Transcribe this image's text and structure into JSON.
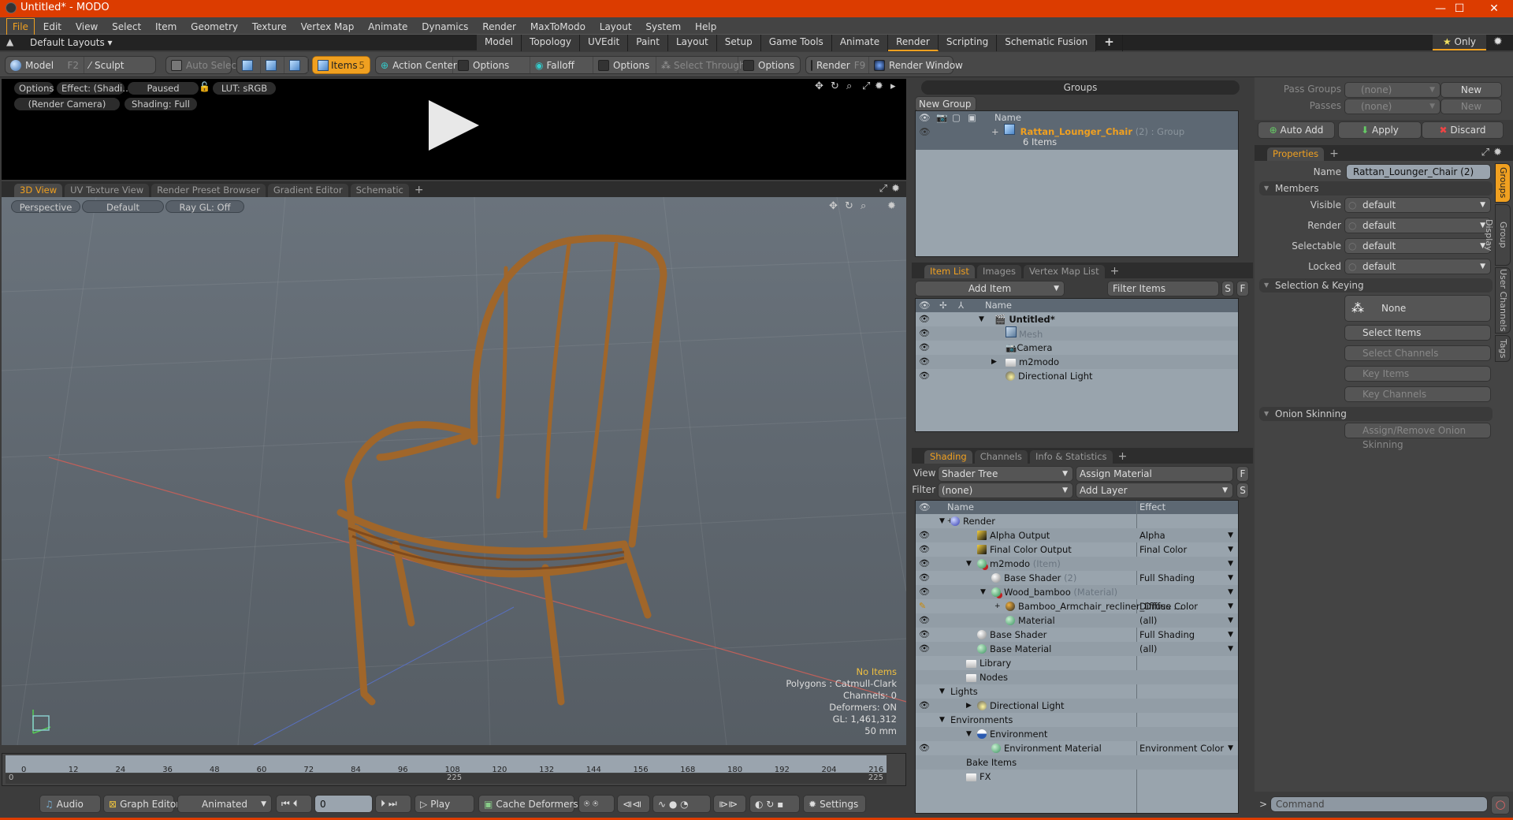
{
  "window": {
    "title": "Untitled* - MODO",
    "controls": [
      "minimize",
      "maximize",
      "close"
    ]
  },
  "menu": [
    "File",
    "Edit",
    "View",
    "Select",
    "Item",
    "Geometry",
    "Texture",
    "Vertex Map",
    "Animate",
    "Dynamics",
    "Render",
    "MaxToModo",
    "Layout",
    "System",
    "Help"
  ],
  "layout_bar": {
    "layouts_label": "Default Layouts",
    "tabs": [
      "Model",
      "Topology",
      "UVEdit",
      "Paint",
      "Layout",
      "Setup",
      "Game Tools",
      "Animate",
      "Render",
      "Scripting",
      "Schematic Fusion"
    ],
    "active_tab": "Render",
    "only_label": "Only"
  },
  "toolbar": {
    "model": "Model",
    "model_key": "F2",
    "sculpt": "Sculpt",
    "auto_select": "Auto Select",
    "items": "Items",
    "items_count": "5",
    "action_center": "Action Center",
    "options1": "Options",
    "falloff": "Falloff",
    "options2": "Options",
    "select_through": "Select Through",
    "options3": "Options",
    "render": "Render",
    "render_key": "F9",
    "render_window": "Render Window"
  },
  "render_view": {
    "options": "Options",
    "effect": "Effect: (Shadi…",
    "status": "Paused",
    "lut": "LUT: sRGB",
    "camera": "(Render Camera)",
    "shading": "Shading: Full"
  },
  "view_tabs": {
    "tabs": [
      "3D View",
      "UV Texture View",
      "Render Preset Browser",
      "Gradient Editor",
      "Schematic"
    ],
    "active": "3D View"
  },
  "viewport": {
    "perspective": "Perspective",
    "style": "Default",
    "raygl": "Ray GL: Off",
    "stats": {
      "selection": "No Items",
      "polygons": "Polygons : Catmull-Clark",
      "channels": "Channels: 0",
      "deformers": "Deformers: ON",
      "gl": "GL: 1,461,312",
      "focal": "50 mm"
    }
  },
  "timeline": {
    "ticks": [
      "0",
      "12",
      "24",
      "36",
      "48",
      "60",
      "72",
      "84",
      "96",
      "108",
      "120",
      "132",
      "144",
      "156",
      "168",
      "180",
      "192",
      "204",
      "216"
    ],
    "range_start": "0",
    "range_mid": "225",
    "range_end": "225"
  },
  "transport": {
    "audio": "Audio",
    "graph_editor": "Graph Editor",
    "mode": "Animated",
    "frame": "0",
    "play": "Play",
    "cache_deformers": "Cache Deformers",
    "settings": "Settings"
  },
  "groups": {
    "title": "Groups",
    "new_group": "New Group",
    "col_name": "Name",
    "rows": [
      {
        "name": "Rattan_Lounger_Chair",
        "count": "(2)",
        "type": ": Group",
        "items": "6 Items"
      }
    ]
  },
  "item_list": {
    "tabs": [
      "Item List",
      "Images",
      "Vertex Map List"
    ],
    "active": "Item List",
    "add_item": "Add Item",
    "filter_placeholder": "Filter Items",
    "s_btn": "S",
    "f_btn": "F",
    "col_name": "Name",
    "rows": [
      {
        "name": "Untitled*",
        "kind": "scene"
      },
      {
        "name": "Mesh",
        "kind": "mesh"
      },
      {
        "name": "Camera",
        "kind": "camera"
      },
      {
        "name": "m2modo",
        "kind": "group"
      },
      {
        "name": "Directional Light",
        "kind": "light"
      }
    ]
  },
  "shading": {
    "tabs": [
      "Shading",
      "Channels",
      "Info & Statistics"
    ],
    "active": "Shading",
    "view_label": "View",
    "view_value": "Shader Tree",
    "assign_material": "Assign Material",
    "f_btn": "F",
    "filter_label": "Filter",
    "filter_value": "(none)",
    "add_layer": "Add Layer",
    "s_btn": "S",
    "col_name": "Name",
    "col_effect": "Effect",
    "rows": [
      {
        "name": "Render",
        "suffix": "",
        "effect": ""
      },
      {
        "name": "Alpha Output",
        "suffix": "",
        "effect": "Alpha"
      },
      {
        "name": "Final Color Output",
        "suffix": "",
        "effect": "Final Color"
      },
      {
        "name": "m2modo",
        "suffix": "(Item)",
        "effect": ""
      },
      {
        "name": "Base Shader",
        "suffix": "(2)",
        "effect": "Full Shading"
      },
      {
        "name": "Wood_bamboo",
        "suffix": "(Material)",
        "effect": ""
      },
      {
        "name": "Bamboo_Armchair_recliner_Diffus …",
        "suffix": "",
        "effect": "Diffuse Color"
      },
      {
        "name": "Material",
        "suffix": "",
        "effect": "(all)"
      },
      {
        "name": "Base Shader",
        "suffix": "",
        "effect": "Full Shading"
      },
      {
        "name": "Base Material",
        "suffix": "",
        "effect": "(all)"
      },
      {
        "name": "Library",
        "suffix": "",
        "effect": ""
      },
      {
        "name": "Nodes",
        "suffix": "",
        "effect": ""
      },
      {
        "name": "Lights",
        "suffix": "",
        "effect": ""
      },
      {
        "name": "Directional Light",
        "suffix": "",
        "effect": ""
      },
      {
        "name": "Environments",
        "suffix": "",
        "effect": ""
      },
      {
        "name": "Environment",
        "suffix": "",
        "effect": ""
      },
      {
        "name": "Environment Material",
        "suffix": "",
        "effect": "Environment Color"
      },
      {
        "name": "Bake Items",
        "suffix": "",
        "effect": ""
      },
      {
        "name": "FX",
        "suffix": "",
        "effect": ""
      }
    ]
  },
  "passes": {
    "pass_groups_label": "Pass Groups",
    "pass_groups_value": "(none)",
    "new1": "New",
    "passes_label": "Passes",
    "passes_value": "(none)",
    "new2": "New",
    "auto_add": "Auto Add",
    "apply": "Apply",
    "discard": "Discard"
  },
  "properties": {
    "tab": "Properties",
    "name_label": "Name",
    "name_value": "Rattan_Lounger_Chair (2)",
    "members": "Members",
    "fields": [
      {
        "label": "Visible",
        "value": "default"
      },
      {
        "label": "Render",
        "value": "default"
      },
      {
        "label": "Selectable",
        "value": "default"
      },
      {
        "label": "Locked",
        "value": "default"
      }
    ],
    "selection_keying": "Selection & Keying",
    "none": "None",
    "select_items": "Select Items",
    "select_channels": "Select Channels",
    "key_items": "Key Items",
    "key_channels": "Key Channels",
    "onion_skinning": "Onion Skinning",
    "assign_onion": "Assign/Remove Onion Skinning",
    "side_tabs": [
      "Groups",
      "Group Display",
      "User Channels",
      "Tags"
    ]
  },
  "command": {
    "placeholder": "Command",
    "prompt": ">"
  }
}
